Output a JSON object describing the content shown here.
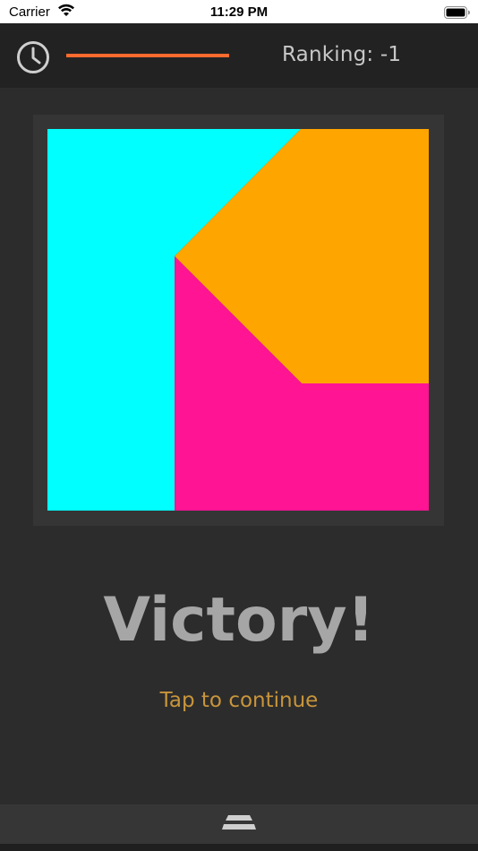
{
  "status_bar": {
    "carrier": "Carrier",
    "time": "11:29 PM"
  },
  "header": {
    "ranking": "Ranking: -1",
    "timer_progress": 1.0,
    "timer_color": "#ff6a2e"
  },
  "board": {
    "colors": {
      "cyan": "#00ffff",
      "orange": "#ffa500",
      "pink": "#ff1493"
    }
  },
  "victory": {
    "title": "Victory!",
    "continue_label": "Tap to continue"
  },
  "icons": {
    "clock": "clock-icon",
    "wifi": "wifi-icon",
    "battery": "battery-icon",
    "menu": "menu-handle-icon"
  }
}
